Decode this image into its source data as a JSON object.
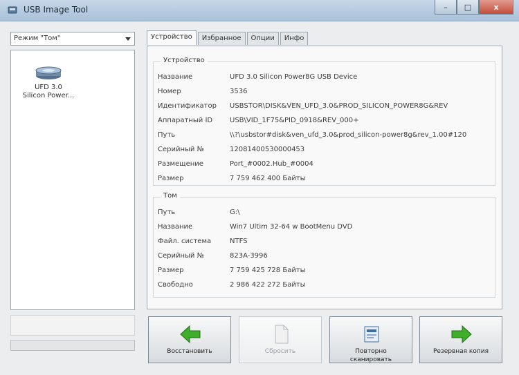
{
  "window": {
    "title": "USB Image Tool",
    "minimize": "–",
    "maximize": "□",
    "close": "x"
  },
  "mode_select": {
    "value": "Режим \"Том\""
  },
  "device_list": {
    "items": [
      {
        "label_line1": "UFD 3.0",
        "label_line2": "Silicon Power..."
      }
    ]
  },
  "progress": {
    "fraction": 0.0
  },
  "tabs": [
    {
      "label": "Устройство"
    },
    {
      "label": "Избранное"
    },
    {
      "label": "Опции"
    },
    {
      "label": "Инфо"
    }
  ],
  "device_group": {
    "title": "Устройство",
    "rows": [
      {
        "key": "Название",
        "value": "UFD 3.0 Silicon Power8G USB Device"
      },
      {
        "key": "Номер",
        "value": "3536"
      },
      {
        "key": "Идентификатор",
        "value": "USBSTOR\\DISK&VEN_UFD_3.0&PROD_SILICON_POWER8G&REV"
      },
      {
        "key": "Аппаратный ID",
        "value": "USB\\VID_1F75&PID_0918&REV_000+"
      },
      {
        "key": "Путь",
        "value": "\\\\?\\usbstor#disk&ven_ufd_3.0&prod_silicon-power8g&rev_1.00#120"
      },
      {
        "key": "Серийный №",
        "value": "12081400530000453"
      },
      {
        "key": "Размещение",
        "value": "Port_#0002.Hub_#0004"
      },
      {
        "key": "Размер",
        "value": "7 759 462 400 Байты"
      }
    ]
  },
  "volume_group": {
    "title": "Том",
    "rows": [
      {
        "key": "Путь",
        "value": "G:\\"
      },
      {
        "key": "Название",
        "value": "Win7 Ultim 32-64 w BootMenu DVD"
      },
      {
        "key": "Файл. система",
        "value": "NTFS"
      },
      {
        "key": "Серийный №",
        "value": "823A-3996"
      },
      {
        "key": "Размер",
        "value": "7 759 425 728 Байты"
      },
      {
        "key": "Свободно",
        "value": "2 986 422 272 Байты"
      }
    ]
  },
  "buttons": {
    "restore": {
      "label": "Восстановить"
    },
    "save": {
      "label": "Сбросить"
    },
    "rescan": {
      "label_line1": "Повторно",
      "label_line2": "сканировать"
    },
    "backup": {
      "label": "Резервная копия"
    }
  },
  "colors": {
    "arrow_green": "#3fae2a",
    "selection_blue": "#3a6ea5"
  }
}
